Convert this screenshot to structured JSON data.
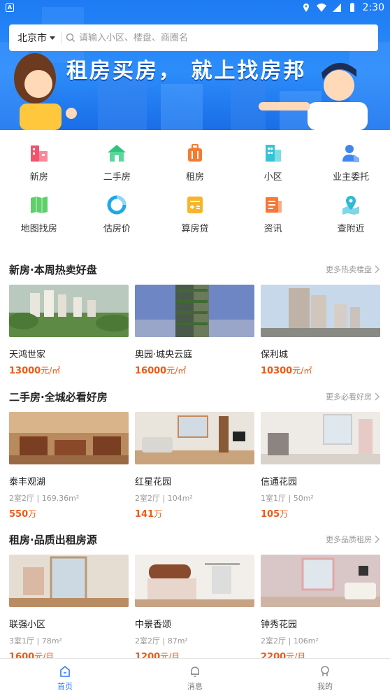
{
  "status": {
    "time": "2:30",
    "app_glyph": "A"
  },
  "search": {
    "city": "北京市",
    "placeholder": "请输入小区、楼盘、商圈名"
  },
  "banner": {
    "title": "租房买房，  就上找房邦"
  },
  "grid": [
    {
      "label": "新房",
      "icon": "new-house-icon",
      "color": "#f2556b"
    },
    {
      "label": "二手房",
      "icon": "second-hand-house-icon",
      "color": "#2dc57e"
    },
    {
      "label": "租房",
      "icon": "rent-luggage-icon",
      "color": "#f57b32"
    },
    {
      "label": "小区",
      "icon": "community-building-icon",
      "color": "#37c3d6"
    },
    {
      "label": "业主委托",
      "icon": "owner-entrust-icon",
      "color": "#3f86f0"
    },
    {
      "label": "地图找房",
      "icon": "map-icon",
      "color": "#5fcf6a"
    },
    {
      "label": "估房价",
      "icon": "pie-chart-icon",
      "color": "#1fa7e8"
    },
    {
      "label": "算房贷",
      "icon": "calculator-icon",
      "color": "#f6b52a"
    },
    {
      "label": "资讯",
      "icon": "news-icon",
      "color": "#f4783a"
    },
    {
      "label": "查附近",
      "icon": "location-icon",
      "color": "#2fb9d2"
    }
  ],
  "sections": [
    {
      "title": "新房·本周热卖好盘",
      "more": "更多热卖楼盘",
      "cards": [
        {
          "name": "天鸿世家",
          "spec": "",
          "price": "13000",
          "unit": "元/㎡"
        },
        {
          "name": "奥园·城央云庭",
          "spec": "",
          "price": "16000",
          "unit": "元/㎡"
        },
        {
          "name": "保利城",
          "spec": "",
          "price": "10300",
          "unit": "元/㎡"
        }
      ]
    },
    {
      "title": "二手房·全城必看好房",
      "more": "更多必看好房",
      "cards": [
        {
          "name": "泰丰观湖",
          "spec": "2室2厅 | 169.36m²",
          "price": "550",
          "unit": "万"
        },
        {
          "name": "红星花园",
          "spec": "2室2厅 | 104m²",
          "price": "141",
          "unit": "万"
        },
        {
          "name": "信通花园",
          "spec": "1室1厅 | 50m²",
          "price": "105",
          "unit": "万"
        }
      ]
    },
    {
      "title": "租房·品质出租房源",
      "more": "更多品质租房",
      "cards": [
        {
          "name": "联强小区",
          "spec": "3室1厅 | 78m²",
          "price": "1600",
          "unit": "元/月"
        },
        {
          "name": "中景香颂",
          "spec": "2室2厅 | 87m²",
          "price": "1200",
          "unit": "元/月"
        },
        {
          "name": "钟秀花园",
          "spec": "2室2厅 | 106m²",
          "price": "2200",
          "unit": "元/月"
        }
      ]
    }
  ],
  "tabs": [
    {
      "label": "首页",
      "icon": "home-icon",
      "active": true
    },
    {
      "label": "消息",
      "icon": "bell-icon",
      "active": false
    },
    {
      "label": "我的",
      "icon": "user-icon",
      "active": false
    }
  ],
  "colors": {
    "accent": "#2f7cf6",
    "price": "#f05a14",
    "banner": "#1e7bf3"
  }
}
